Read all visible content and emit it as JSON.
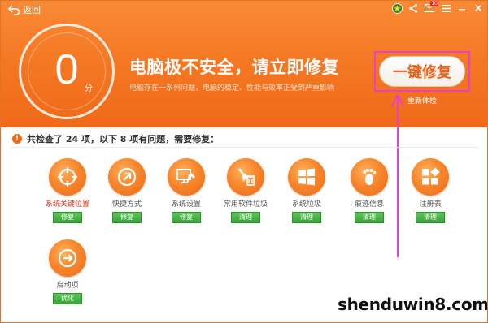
{
  "topbar": {
    "back_label": "返回",
    "icons": [
      "app-logo-icon",
      "share-icon",
      "message-icon",
      "menu-icon",
      "minimize-icon",
      "close-icon"
    ],
    "message_badge": "10"
  },
  "score": {
    "value": "0",
    "unit": "分"
  },
  "headline": "电脑极不安全，请立即修复",
  "subline": "电脑存在一系列问题，电脑的稳定、性能与效率正受到严重影响",
  "fix_button": "一键修复",
  "recheck_link": "重新体检",
  "summary": "共检查了 24 项，以下 8 项有问题，需要修复：",
  "colors": {
    "header_orange": "#f47622",
    "action_green": "#38a436",
    "alert_red": "#d7381c",
    "annotation_magenta": "#e83fd0"
  },
  "items": [
    {
      "label": "系统关键位置",
      "button": "修复",
      "icon": "crosshair-icon"
    },
    {
      "label": "快捷方式",
      "button": "修复",
      "icon": "shortcut-arrow-icon"
    },
    {
      "label": "系统设置",
      "button": "修复",
      "icon": "monitor-wrench-icon"
    },
    {
      "label": "常用软件垃圾",
      "button": "清理",
      "icon": "brush-trash-icon"
    },
    {
      "label": "系统垃圾",
      "button": "清理",
      "icon": "windows-logo-icon"
    },
    {
      "label": "痕迹信息",
      "button": "清理",
      "icon": "footprint-icon"
    },
    {
      "label": "注册表",
      "button": "清理",
      "icon": "registry-blocks-icon"
    },
    {
      "label": "启动项",
      "button": "优化",
      "icon": "startup-arrow-icon"
    }
  ],
  "watermark": "shenduwin8.com"
}
